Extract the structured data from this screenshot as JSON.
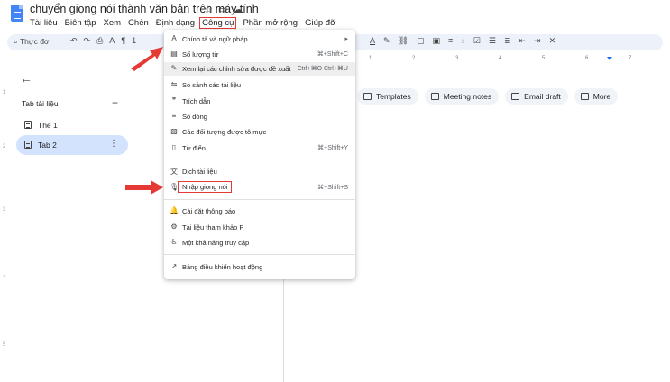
{
  "document": {
    "title": "chuyển giọng nói thành văn bản trên máy tính",
    "title_icons": [
      "star-icon",
      "folder-move-icon",
      "cloud-status-icon"
    ]
  },
  "menubar": {
    "items": [
      "Tài liệu",
      "Biên tập",
      "Xem",
      "Chèn",
      "Định dạng",
      "Công cụ",
      "Phần mở rộng",
      "Giúp đỡ"
    ],
    "active_index": 5
  },
  "toolbar": {
    "search_label": "Thực đơ",
    "zoom_value": "1"
  },
  "ruler": {
    "ticks": [
      "1",
      "2",
      "3",
      "4",
      "5",
      "6",
      "7"
    ]
  },
  "vertical_ruler": {
    "ticks": [
      "1",
      "2",
      "3",
      "4",
      "5"
    ]
  },
  "sidebar": {
    "header": "Tab tài liệu",
    "add_symbol": "+",
    "tabs": [
      {
        "label": "Thẻ 1",
        "selected": false
      },
      {
        "label": "Tab 2",
        "selected": true
      }
    ]
  },
  "chips": [
    {
      "label": "Templates",
      "icon": "templates-icon"
    },
    {
      "label": "Meeting notes",
      "icon": "meeting-notes-icon"
    },
    {
      "label": "Email draft",
      "icon": "email-draft-icon"
    },
    {
      "label": "More",
      "icon": "more-icon"
    }
  ],
  "tools_menu": {
    "items": [
      {
        "label": "Chính tả và ngữ pháp",
        "icon": "spellcheck-icon",
        "shortcut": "",
        "submenu": true
      },
      {
        "label": "Số lượng từ",
        "icon": "word-count-icon",
        "shortcut": "⌘+Shift+C"
      },
      {
        "label": "Xem lại các chỉnh sửa được đề xuất",
        "icon": "review-edits-icon",
        "shortcut": "Ctrl+⌘O Ctrl+⌘U"
      },
      {
        "label": "So sánh các tài liệu",
        "icon": "compare-documents-icon",
        "shortcut": ""
      },
      {
        "label": "Trích dẫn",
        "icon": "citations-icon",
        "shortcut": ""
      },
      {
        "label": "Số dòng",
        "icon": "line-numbers-icon",
        "shortcut": ""
      },
      {
        "label": "Các đối tượng được tô mực",
        "icon": "linked-objects-icon",
        "shortcut": ""
      },
      {
        "label": "Từ điển",
        "icon": "dictionary-icon",
        "shortcut": "⌘+Shift+Y"
      },
      {
        "label": "Dịch tài liệu",
        "icon": "translate-icon",
        "shortcut": ""
      },
      {
        "label": "Nhập giọng nói",
        "icon": "microphone-icon",
        "shortcut": "⌘+Shift+S"
      },
      {
        "label": "Cài đặt thông báo",
        "icon": "notification-bell-icon",
        "shortcut": ""
      },
      {
        "label": "Tài liệu tham khảo P",
        "icon": "preferences-icon",
        "shortcut": ""
      },
      {
        "label": "Một khả năng truy cập",
        "icon": "accessibility-icon",
        "shortcut": ""
      },
      {
        "label": "Bảng điều khiển hoạt động",
        "icon": "activity-dashboard-icon",
        "shortcut": ""
      }
    ]
  },
  "colors": {
    "accent_blue": "#1a73e8",
    "toolbar_bg": "#edf2fa",
    "selected_tab_bg": "#d3e3fd",
    "annotation_red": "#e53935"
  }
}
